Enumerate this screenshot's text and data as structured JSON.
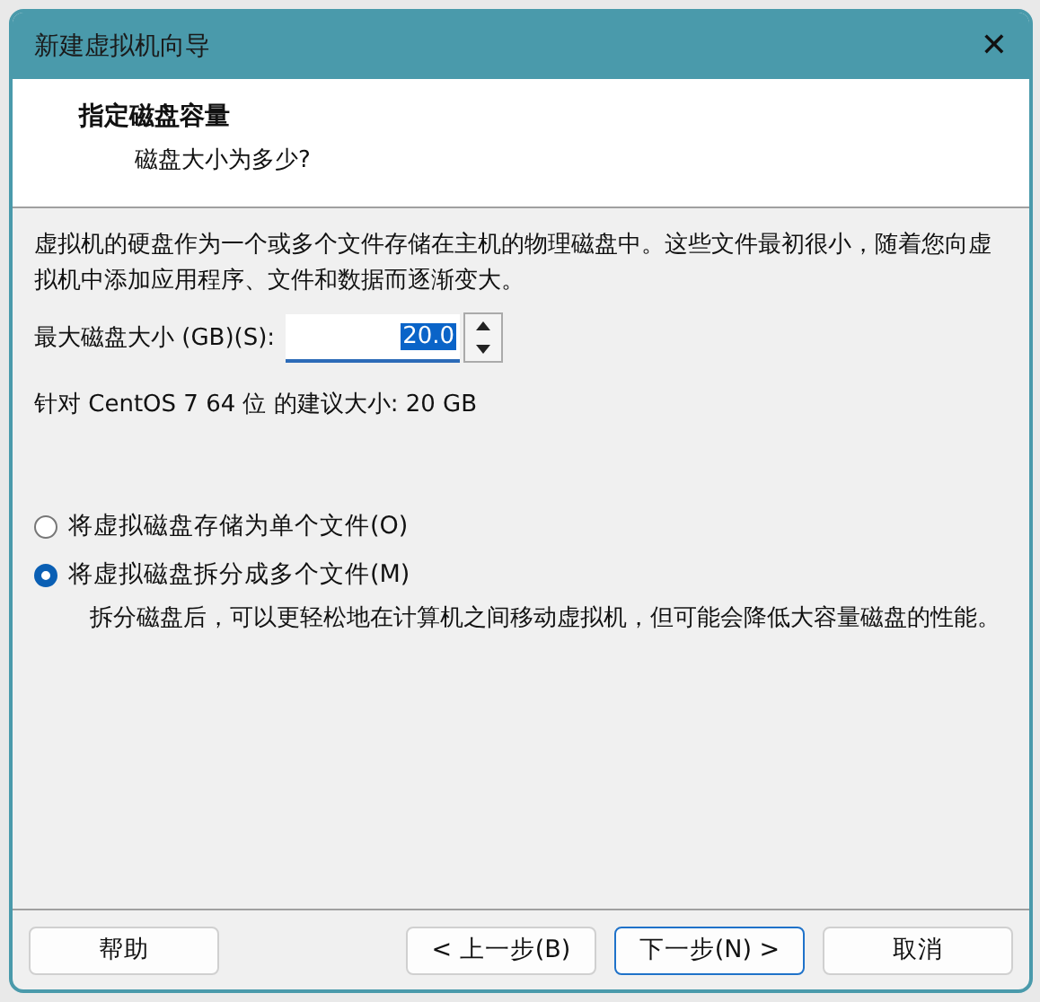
{
  "window": {
    "title": "新建虚拟机向导",
    "close": "✕"
  },
  "header": {
    "title": "指定磁盘容量",
    "subtitle": "磁盘大小为多少?"
  },
  "description": "虚拟机的硬盘作为一个或多个文件存储在主机的物理磁盘中。这些文件最初很小，随着您向虚拟机中添加应用程序、文件和数据而逐渐变大。",
  "disk_size": {
    "label": "最大磁盘大小 (GB)(S):",
    "value": "20.0",
    "selected_text": true
  },
  "recommendation": "针对 CentOS 7 64 位 的建议大小: 20 GB",
  "options": [
    {
      "label": "将虚拟磁盘存储为单个文件(O)",
      "selected": false
    },
    {
      "label": "将虚拟磁盘拆分成多个文件(M)",
      "selected": true,
      "note": "拆分磁盘后，可以更轻松地在计算机之间移动虚拟机，但可能会降低大容量磁盘的性能。"
    }
  ],
  "buttons": [
    {
      "label": "帮助",
      "focused": false
    },
    {
      "label": "< 上一步(B)",
      "focused": false
    },
    {
      "label": "下一步(N) >",
      "focused": true
    },
    {
      "label": "取消",
      "focused": false
    }
  ]
}
